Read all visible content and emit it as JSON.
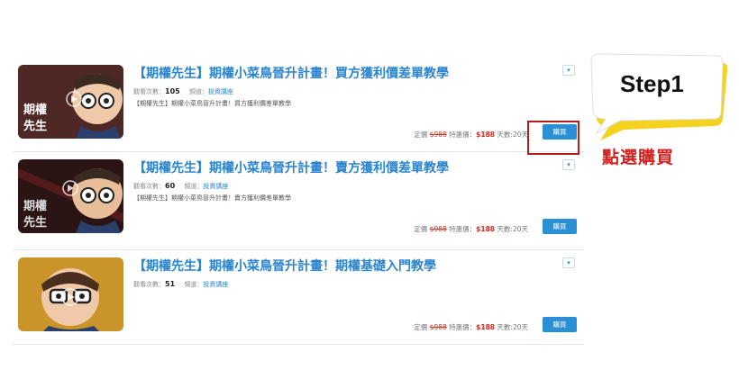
{
  "items": [
    {
      "title": "【期權先生】期權小菜鳥晉升計畫！買方獲利價差單教學",
      "views_label": "觀看次數：",
      "views": "105",
      "channel_label": "頻道：",
      "channel": "投資講座",
      "description": "【期權先生】期權小菜鳥晉升計畫！買方獲利價差單教學",
      "list_price_label": "定價",
      "list_price": "$988",
      "sale_price_label": "特惠價：",
      "sale_price": "$188",
      "days": "天數:20天",
      "buy_label": "購買",
      "thumb_text_1": "期權",
      "thumb_text_2": "先生"
    },
    {
      "title": "【期權先生】期權小菜鳥晉升計畫！賣方獲利價差單教學",
      "views_label": "觀看次數：",
      "views": "60",
      "channel_label": "頻道：",
      "channel": "投資講座",
      "description": "【期權先生】期權小菜鳥晉升計畫！賣方獲利價差單教學",
      "list_price_label": "定價",
      "list_price": "$988",
      "sale_price_label": "特惠價：",
      "sale_price": "$188",
      "days": "天數:20天",
      "buy_label": "購買",
      "thumb_text_1": "期權",
      "thumb_text_2": "先生"
    },
    {
      "title": "【期權先生】期權小菜鳥晉升計畫！期權基礎入門教學",
      "views_label": "觀看次數：",
      "views": "51",
      "channel_label": "頻道：",
      "channel": "投資講座",
      "description": "",
      "list_price_label": "定價",
      "list_price": "$988",
      "sale_price_label": "特惠價：",
      "sale_price": "$188",
      "days": "天數:20天",
      "buy_label": "購買"
    }
  ],
  "callout": {
    "step": "Step1",
    "instruction": "點選購買"
  },
  "icons": {
    "expand": "chevron-down-icon",
    "play": "play-icon"
  },
  "colors": {
    "title_blue": "#2b84cf",
    "buy_button": "#2b8fd6",
    "sale_red": "#e0241c",
    "highlight": "#b51c1c",
    "bubble_yellow": "#f5d21f"
  }
}
